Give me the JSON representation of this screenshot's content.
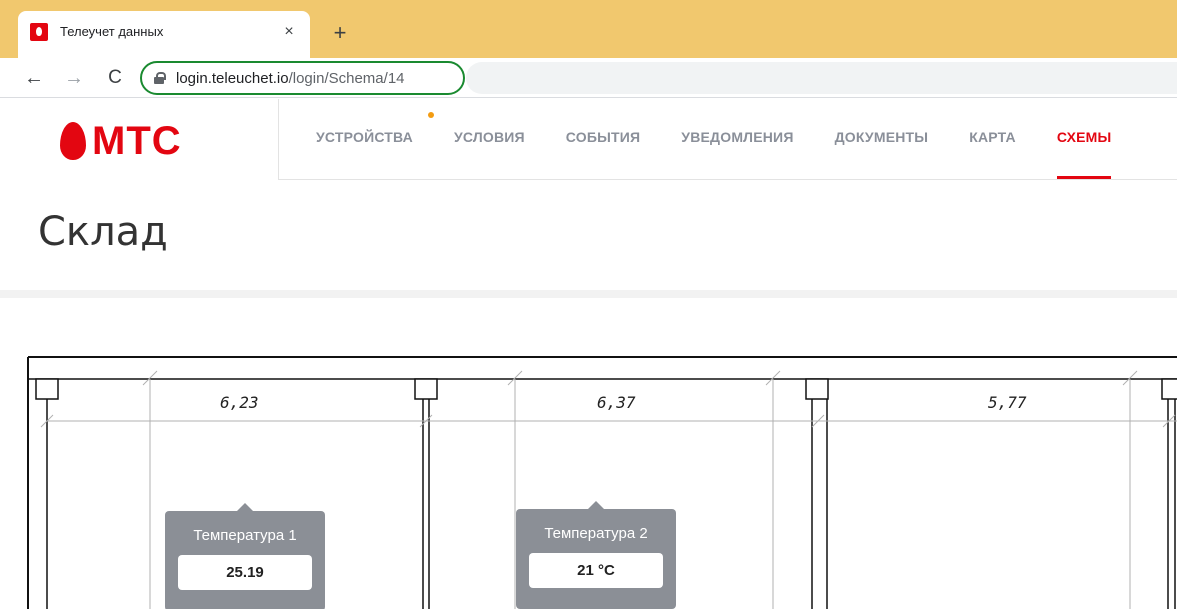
{
  "browser": {
    "tab_title": "Телеучет данных",
    "tab_close": "×",
    "new_tab": "+",
    "back": "←",
    "forward": "→",
    "reload": "C",
    "url_host": "login.teleuchet.io",
    "url_path": "/login/Schema/14"
  },
  "brand": {
    "logo_text": "МТС",
    "color": "#e30611"
  },
  "nav": {
    "items": [
      {
        "label": "УСТРОЙСТВА"
      },
      {
        "label": "УСЛОВИЯ"
      },
      {
        "label": "СОБЫТИЯ"
      },
      {
        "label": "УВЕДОМЛЕНИЯ"
      },
      {
        "label": "ДОКУМЕНТЫ"
      },
      {
        "label": "КАРТА"
      },
      {
        "label": "СХЕМЫ",
        "active": true
      }
    ],
    "active_color": "#e30611",
    "notify_dot_color": "#f39c12"
  },
  "page": {
    "title": "Склад"
  },
  "schema": {
    "dimensions": [
      "6,23",
      "6,37",
      "5,77"
    ],
    "sensors": [
      {
        "title": "Температура 1",
        "value": "25.19"
      },
      {
        "title": "Температура 2",
        "value": "21 °C"
      }
    ]
  }
}
